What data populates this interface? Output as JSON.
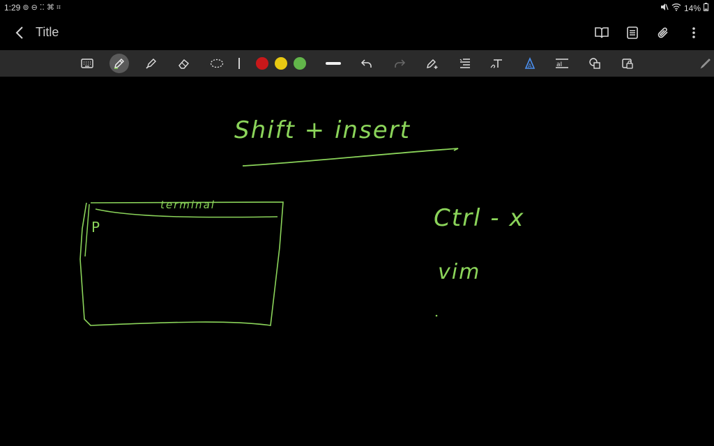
{
  "status_bar": {
    "time": "1:29",
    "left_glyphs": "⊚ ⊖ ⁚⁚ ⌘ ⌗",
    "battery": "14%"
  },
  "header": {
    "title": "Title"
  },
  "toolbar": {
    "tools": [
      {
        "name": "keyboard-icon"
      },
      {
        "name": "pen-icon",
        "active": true
      },
      {
        "name": "highlighter-icon"
      },
      {
        "name": "eraser-icon"
      },
      {
        "name": "lasso-icon"
      }
    ],
    "colors": [
      "#c8181a",
      "#e8c912",
      "#62b54a"
    ],
    "right_tools": [
      "stroke-width-icon",
      "undo-icon",
      "redo-icon",
      "pen-add-icon",
      "text-align-icon",
      "handwriting-to-text-icon",
      "shape-recognition-icon",
      "text-box-icon",
      "shapes-icon",
      "lock-icon"
    ]
  },
  "canvas": {
    "heading": "Shift + insert",
    "window_title": "terminal",
    "prompt": "P",
    "note_1": "Ctrl - x",
    "note_2": "vim"
  },
  "colors": {
    "ink": "#8bd45a",
    "toolbar_bg": "#2b2b2b",
    "background": "#000000"
  }
}
